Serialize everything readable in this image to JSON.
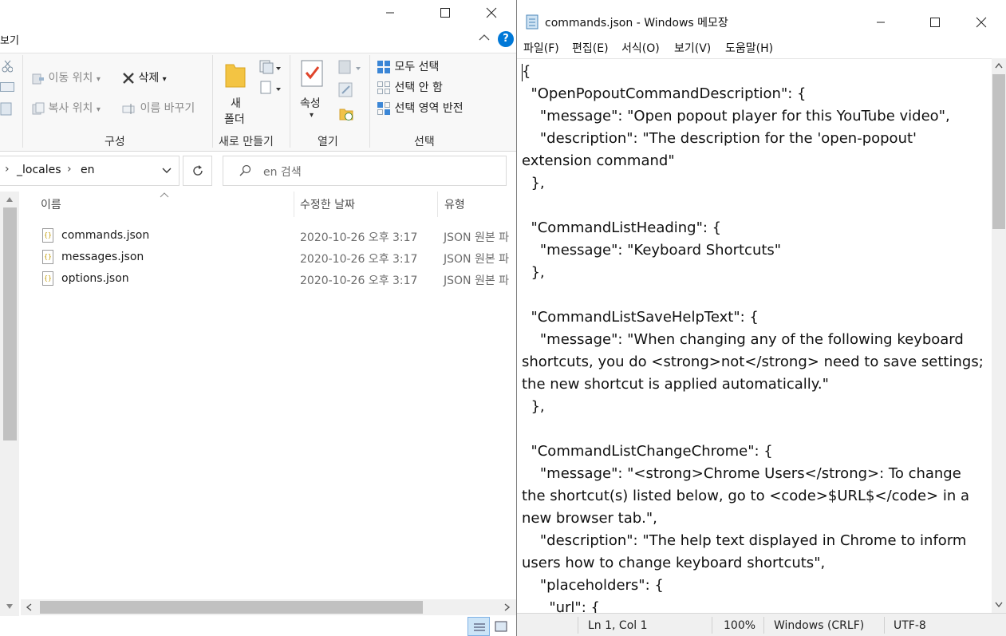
{
  "explorer": {
    "ribbon_tab_partial": "보기",
    "organize": {
      "move_to": "이동 위치",
      "copy_to": "복사 위치",
      "delete": "삭제",
      "rename": "이름 바꾸기",
      "group_label": "구성"
    },
    "new": {
      "new_folder_line1": "새",
      "new_folder_line2": "폴더",
      "group_label": "새로 만들기"
    },
    "open": {
      "properties": "속성",
      "group_label": "열기"
    },
    "select": {
      "select_all": "모두 선택",
      "select_none": "선택 안 함",
      "invert_selection": "선택 영역 반전",
      "group_label": "선택"
    },
    "address": {
      "parent": "_locales",
      "current": "en",
      "search_placeholder": "en 검색"
    },
    "columns": {
      "name": "이름",
      "date_modified": "수정한 날짜",
      "type": "유형"
    },
    "files": [
      {
        "name": "commands.json",
        "date": "2020-10-26 오후 3:17",
        "type": "JSON 원본 파"
      },
      {
        "name": "messages.json",
        "date": "2020-10-26 오후 3:17",
        "type": "JSON 원본 파"
      },
      {
        "name": "options.json",
        "date": "2020-10-26 오후 3:17",
        "type": "JSON 원본 파"
      }
    ]
  },
  "notepad": {
    "title": "commands.json - Windows 메모장",
    "menu": [
      "파일(F)",
      "편집(E)",
      "서식(O)",
      "보기(V)",
      "도움말(H)"
    ],
    "content": "{\n  \"OpenPopoutCommandDescription\": {\n    \"message\": \"Open popout player for this YouTube video\",\n    \"description\": \"The description for the 'open-popout' extension command\"\n  },\n\n  \"CommandListHeading\": {\n    \"message\": \"Keyboard Shortcuts\"\n  },\n\n  \"CommandListSaveHelpText\": {\n    \"message\": \"When changing any of the following keyboard shortcuts, you do <strong>not</strong> need to save settings; the new shortcut is applied automatically.\"\n  },\n\n  \"CommandListChangeChrome\": {\n    \"message\": \"<strong>Chrome Users</strong>: To change the shortcut(s) listed below, go to <code>$URL$</code> in a new browser tab.\",\n    \"description\": \"The help text displayed in Chrome to inform users how to change keyboard shortcuts\",\n    \"placeholders\": {\n      \"url\": {",
    "status": {
      "position": "Ln 1, Col 1",
      "zoom": "100%",
      "line_ending": "Windows (CRLF)",
      "encoding": "UTF-8"
    }
  },
  "colors": {
    "accent": "#0078d7",
    "ribbon_bg": "#f8f8f8",
    "statusbar_bg": "#f0f0f0"
  }
}
